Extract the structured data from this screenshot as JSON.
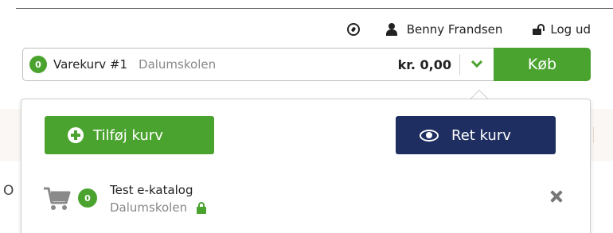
{
  "header": {
    "user_name": "Benny Frandsen",
    "logout_label": "Log ud"
  },
  "cart_bar": {
    "count": "0",
    "cart_name": "Varekurv #1",
    "organization": "Dalumskolen",
    "total": "kr. 0,00",
    "buy_label": "Køb"
  },
  "dropdown": {
    "add_cart_label": "Tilføj kurv",
    "edit_cart_label": "Ret kurv",
    "carts": [
      {
        "count": "0",
        "title": "Test e-katalog",
        "organization": "Dalumskolen"
      }
    ]
  },
  "background": {
    "partial_letter": "O"
  },
  "colors": {
    "accent_green": "#4aa32e",
    "navy": "#1e2e60"
  },
  "icons": [
    "compass-icon",
    "user-icon",
    "unlock-icon",
    "chevron-down-icon",
    "plus-icon",
    "eye-icon",
    "shopping-cart-icon",
    "lock-icon",
    "close-icon"
  ]
}
